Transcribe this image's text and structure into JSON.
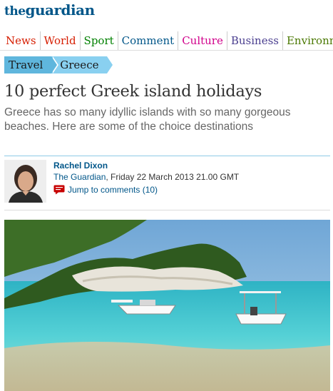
{
  "site": {
    "logo_the": "the",
    "logo_guardian": "guardian",
    "logo_color": "#005689"
  },
  "nav": {
    "items": [
      {
        "label": "News",
        "color": "#d61d00"
      },
      {
        "label": "World",
        "color": "#d61d00"
      },
      {
        "label": "Sport",
        "color": "#008000"
      },
      {
        "label": "Comment",
        "color": "#005689"
      },
      {
        "label": "Culture",
        "color": "#d1008b"
      },
      {
        "label": "Business",
        "color": "#4a3e8f"
      },
      {
        "label": "Environmen",
        "color": "#4a7801"
      }
    ]
  },
  "breadcrumb": {
    "section": "Travel",
    "subsection": "Greece"
  },
  "article": {
    "headline": "10 perfect Greek island holidays",
    "standfirst": "Greece has so many idyllic islands with so many gorgeous beaches. Here are some of the choice destinations",
    "author": "Rachel Dixon",
    "source": "The Guardian",
    "dateline": ", Friday 22 March 2013 21.00 GMT",
    "comments_link": "Jump to comments (10)"
  },
  "icons": {
    "comment": "speech-bubble-icon"
  }
}
